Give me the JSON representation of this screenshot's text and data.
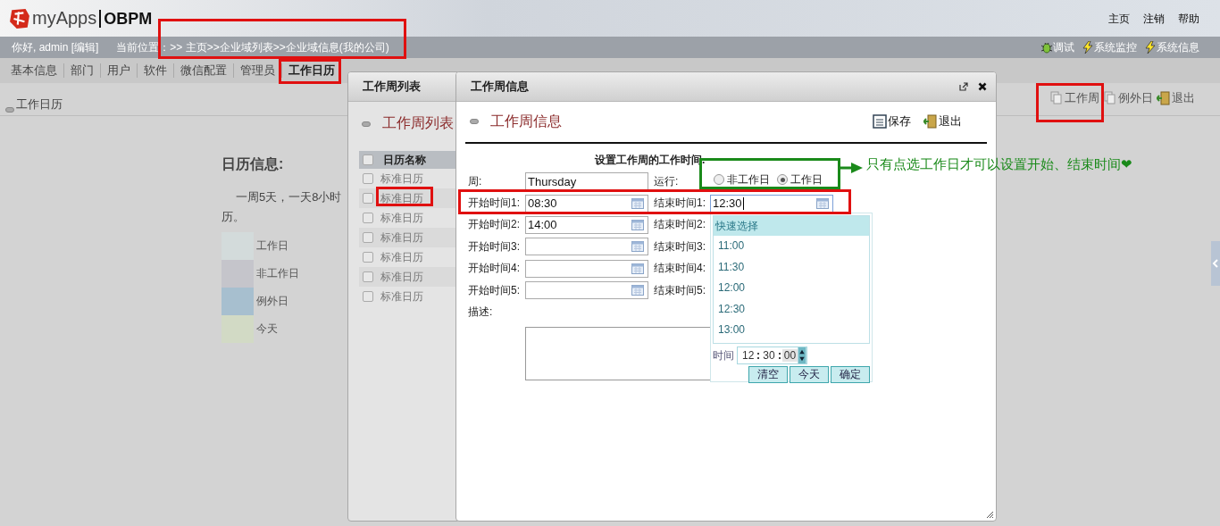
{
  "header": {
    "logo_text": "myApps",
    "product": "OBPM",
    "links": [
      "主页",
      "注销",
      "帮助"
    ]
  },
  "user_bar": {
    "greeting": "你好, admin [编辑]",
    "breadcrumb": "当前位置：>> 主页>>企业域列表>>企业域信息(我的公司)",
    "tools": [
      {
        "kind": "bug",
        "label": "调试"
      },
      {
        "kind": "bolt",
        "label": "系统监控"
      },
      {
        "kind": "bolt",
        "label": "系统信息"
      }
    ]
  },
  "nav_tabs": [
    {
      "label": "基本信息",
      "selected": false
    },
    {
      "label": "部门",
      "selected": false
    },
    {
      "label": "用户",
      "selected": false
    },
    {
      "label": "软件",
      "selected": false
    },
    {
      "label": "微信配置",
      "selected": false
    },
    {
      "label": "管理员",
      "selected": false
    },
    {
      "label": "工作日历",
      "selected": true
    }
  ],
  "sub_bar": {
    "title": "工作日历",
    "actions": [
      {
        "kind": "doc",
        "label": "工作周"
      },
      {
        "kind": "doc",
        "label": "例外日"
      },
      {
        "kind": "exit",
        "label": "退出"
      }
    ]
  },
  "calendar_info": {
    "heading": "日历信息:",
    "text_line1": "一周5天，一天8小时",
    "text_line2": "历。",
    "legend": [
      {
        "label": "工作日",
        "color": "#d3dbdb"
      },
      {
        "label": "非工作日",
        "color": "#c5c5cb"
      },
      {
        "label": "例外日",
        "color": "#a7bfcf"
      },
      {
        "label": "今天",
        "color": "#d2dac5"
      }
    ]
  },
  "list_dialog": {
    "title": "工作周列表",
    "heading": "工作周列表",
    "column": "日历名称",
    "header_checked": false,
    "rows": [
      {
        "name": "标准日历",
        "checked": false
      },
      {
        "name": "标准日历",
        "checked": false
      },
      {
        "name": "标准日历",
        "checked": false
      },
      {
        "name": "标准日历",
        "checked": false
      },
      {
        "name": "标准日历",
        "checked": false
      },
      {
        "name": "标准日历",
        "checked": false
      },
      {
        "name": "标准日历",
        "checked": false
      }
    ]
  },
  "info_dialog": {
    "title": "工作周信息",
    "heading": "工作周信息",
    "actions": [
      {
        "kind": "save",
        "label": "保存"
      },
      {
        "kind": "exit",
        "label": "退出"
      }
    ],
    "form_title": "设置工作周的工作时间.",
    "week_label": "周:",
    "week_value": "Thursday",
    "run_label": "运行:",
    "run_options": [
      {
        "label": "非工作日",
        "selected": false
      },
      {
        "label": "工作日",
        "selected": true
      }
    ],
    "time_rows": [
      {
        "start_label": "开始时间1:",
        "start_value": "08:30",
        "end_label": "结束时间1:",
        "end_value": "12:30"
      },
      {
        "start_label": "开始时间2:",
        "start_value": "14:00",
        "end_label": "结束时间2:"
      },
      {
        "start_label": "开始时间3:",
        "end_label": "结束时间3:"
      },
      {
        "start_label": "开始时间4:",
        "end_label": "结束时间4:"
      },
      {
        "start_label": "开始时间5:",
        "end_label": "结束时间5:"
      }
    ],
    "description_label": "描述:"
  },
  "time_picker": {
    "header": "快速选择",
    "options": [
      "11:00",
      "11:30",
      "12:00",
      "12:30",
      "13:00"
    ],
    "time_label": "时间",
    "hours": "12",
    "minutes": "30",
    "seconds": "00",
    "buttons": [
      "清空",
      "今天",
      "确定"
    ]
  },
  "annotation": {
    "note": "只有点选工作日才可以设置开始、结束时间❤"
  }
}
